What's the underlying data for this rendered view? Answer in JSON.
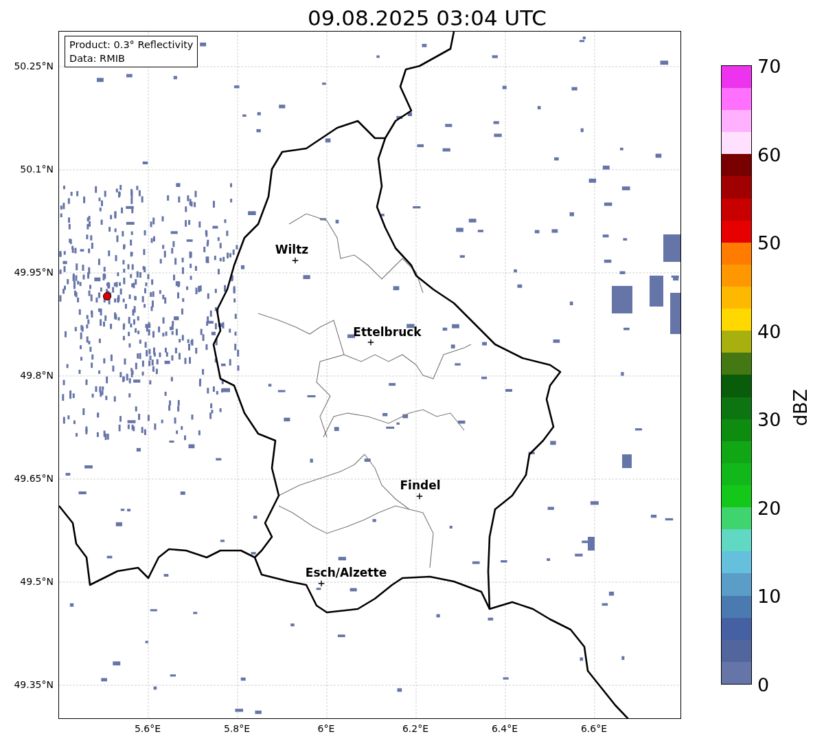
{
  "title": "09.08.2025 03:04 UTC",
  "legend": [
    "Product: 0.3° Reflectivity",
    "Data: RMIB"
  ],
  "cities": [
    {
      "name": "Wiltz"
    },
    {
      "name": "Ettelbruck"
    },
    {
      "name": "Findel"
    },
    {
      "name": "Esch/Alzette"
    }
  ],
  "x_axis": {
    "ticks": [
      "5.6°E",
      "5.8°E",
      "6°E",
      "6.2°E",
      "6.4°E",
      "6.6°E"
    ]
  },
  "y_axis": {
    "ticks": [
      "50.25°N",
      "50.1°N",
      "49.95°N",
      "49.8°N",
      "49.65°N",
      "49.5°N",
      "49.35°N"
    ]
  },
  "colorbar": {
    "label": "dBZ",
    "ticks": [
      "70",
      "60",
      "50",
      "40",
      "30",
      "20",
      "10",
      "0"
    ],
    "segments": [
      {
        "color": "#6675a8"
      },
      {
        "color": "#52669e"
      },
      {
        "color": "#4560a3"
      },
      {
        "color": "#4a7ab0"
      },
      {
        "color": "#5a9ec8"
      },
      {
        "color": "#64c0dc"
      },
      {
        "color": "#60d8c4"
      },
      {
        "color": "#3fd46e"
      },
      {
        "color": "#14c81a"
      },
      {
        "color": "#12b81a"
      },
      {
        "color": "#10a614"
      },
      {
        "color": "#0e8c10"
      },
      {
        "color": "#0c7410"
      },
      {
        "color": "#085c0a"
      },
      {
        "color": "#447812"
      },
      {
        "color": "#a8b010"
      },
      {
        "color": "#ffd800"
      },
      {
        "color": "#ffb800"
      },
      {
        "color": "#ff9800"
      },
      {
        "color": "#ff7c00"
      },
      {
        "color": "#e60000"
      },
      {
        "color": "#c80000"
      },
      {
        "color": "#a00000"
      },
      {
        "color": "#780000"
      },
      {
        "color": "#ffe0ff"
      },
      {
        "color": "#ffb0ff"
      },
      {
        "color": "#ff70ff"
      },
      {
        "color": "#ee33ee"
      }
    ]
  }
}
